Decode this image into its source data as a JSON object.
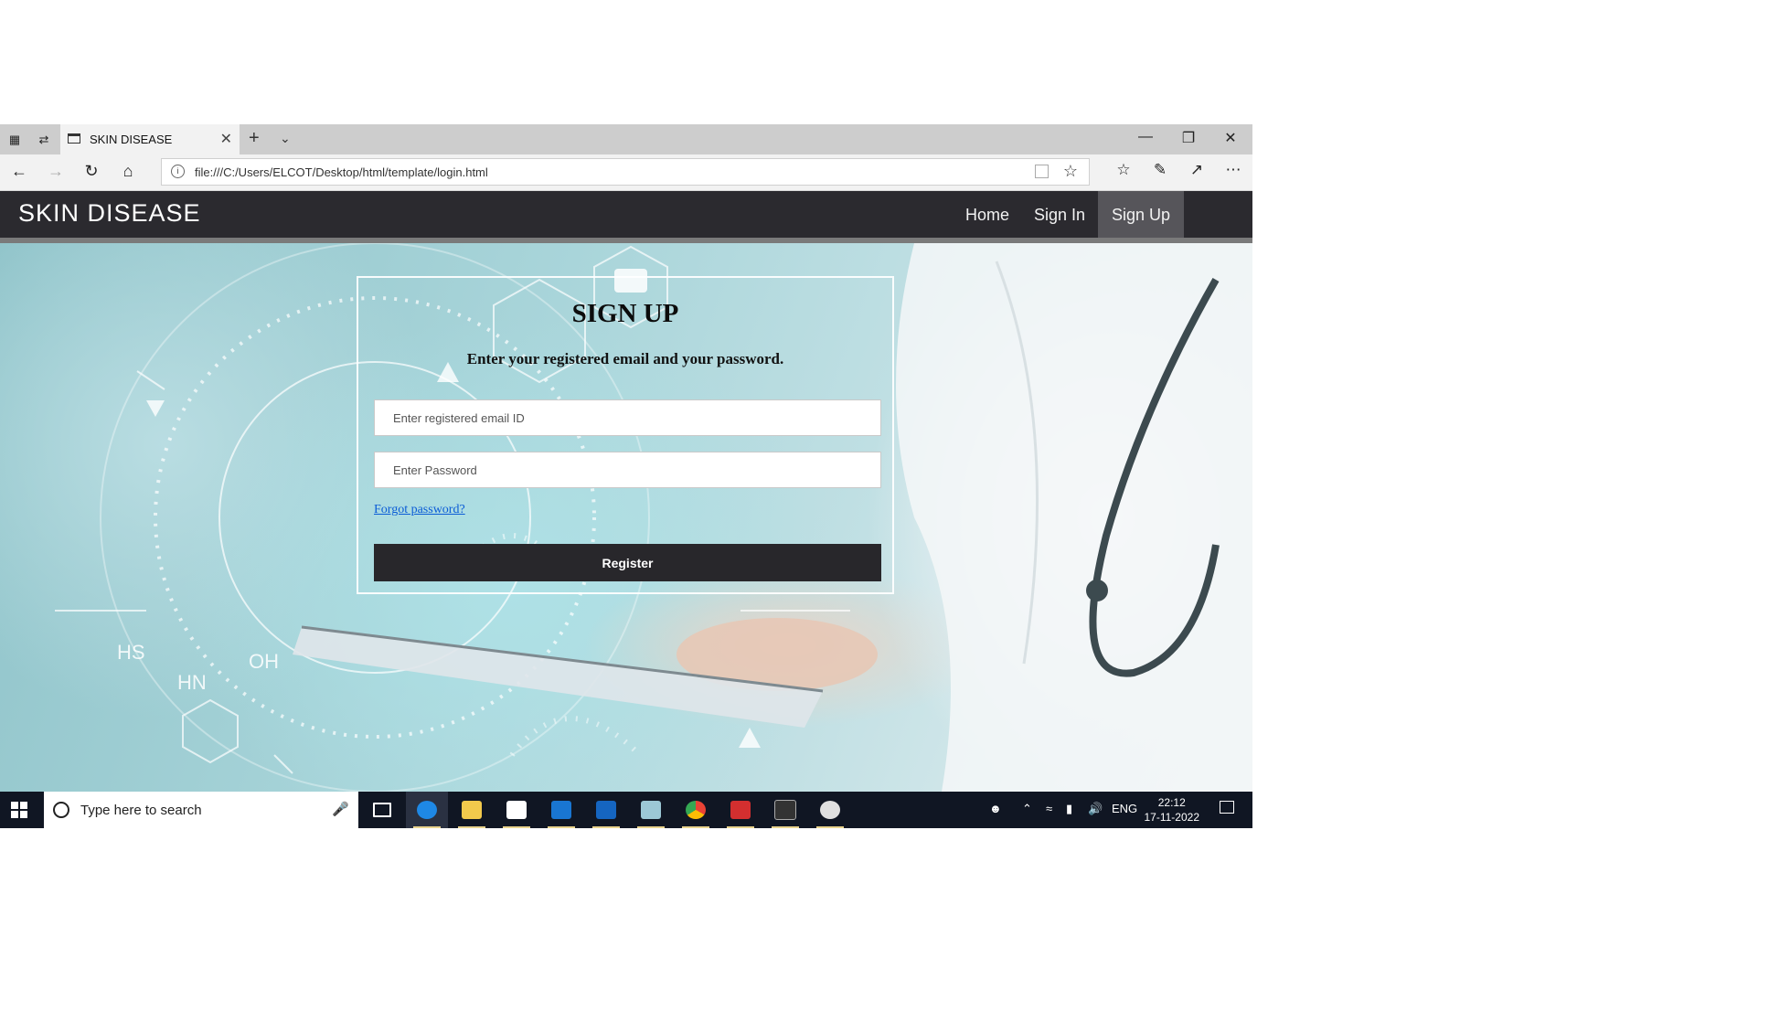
{
  "browser": {
    "tab_title": "SKIN DISEASE",
    "url": "file:///C:/Users/ELCOT/Desktop/html/template/login.html"
  },
  "site": {
    "brand": "SKIN DISEASE",
    "menu": [
      {
        "label": "Home",
        "active": false
      },
      {
        "label": "Sign In",
        "active": false
      },
      {
        "label": "Sign Up",
        "active": true
      }
    ]
  },
  "form": {
    "title": "SIGN UP",
    "subtitle": "Enter your registered email and your password.",
    "email_placeholder": "Enter registered email ID",
    "password_placeholder": "Enter Password",
    "forgot_label": "Forgot password?",
    "register_label": "Register"
  },
  "taskbar": {
    "search_placeholder": "Type here to search",
    "language": "ENG",
    "time": "22:12",
    "date": "17-11-2022",
    "apps": [
      "task-view-icon",
      "edge-icon",
      "file-explorer-icon",
      "store-icon",
      "mail-icon",
      "photos-icon",
      "app-icon",
      "chrome-icon",
      "acrobat-icon",
      "terminal-icon",
      "paint-icon"
    ]
  },
  "colors": {
    "navbar": "#2b2a2f",
    "nav_active": "#56555a",
    "button": "#28272b",
    "link": "#0b5cd6",
    "taskbar": "#101623"
  }
}
